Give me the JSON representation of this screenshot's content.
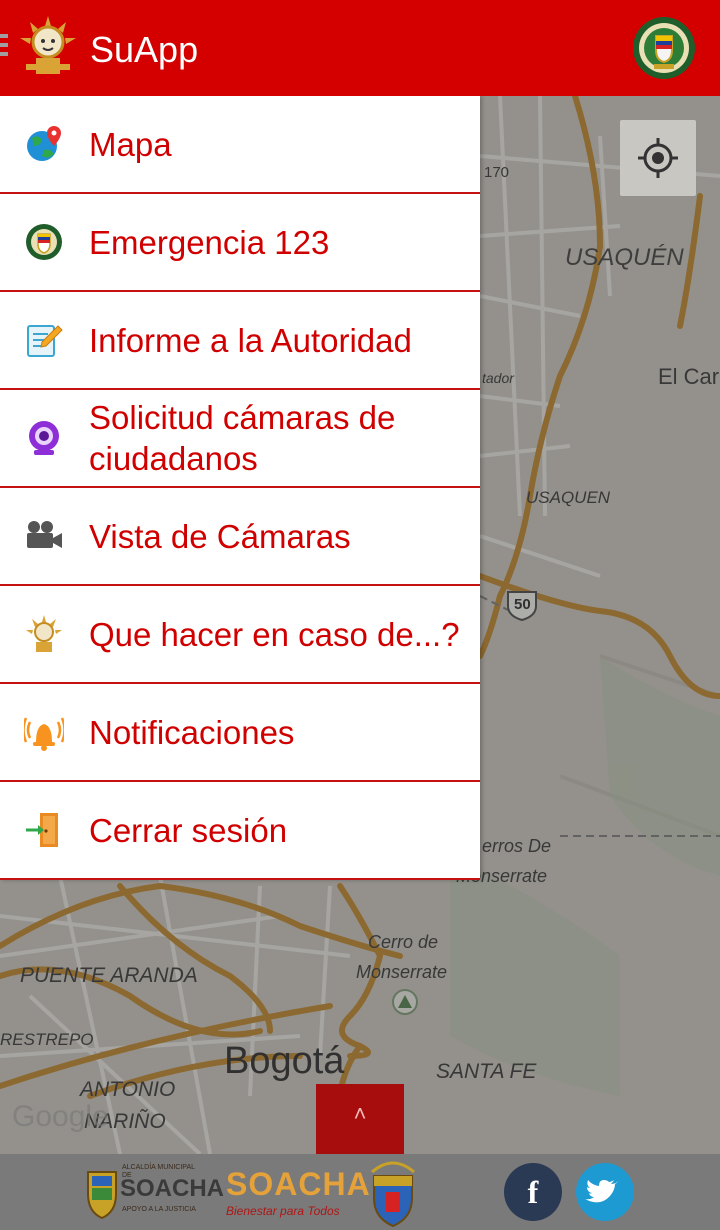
{
  "app": {
    "title": "SuApp"
  },
  "colors": {
    "brand_red": "#d40000",
    "menu_text": "#d10000",
    "divider": "#c41212"
  },
  "header": {
    "menu_icon": "hamburger-icon",
    "logo_icon": "golden-sun-logo",
    "badge_icon": "police-shield-icon"
  },
  "menu": [
    {
      "label": "Mapa",
      "icon": "globe-location-icon"
    },
    {
      "label": "Emergencia 123",
      "icon": "police-badge-icon"
    },
    {
      "label": "Informe a la Autoridad",
      "icon": "notepad-pencil-icon"
    },
    {
      "label": "Solicitud cámaras de ciudadanos",
      "icon": "webcam-icon"
    },
    {
      "label": "Vista de Cámaras",
      "icon": "video-camera-icon"
    },
    {
      "label": "Que hacer en caso de...?",
      "icon": "golden-sun-icon"
    },
    {
      "label": "Notificaciones",
      "icon": "alarm-bell-icon"
    },
    {
      "label": "Cerrar sesión",
      "icon": "exit-door-icon"
    }
  ],
  "map": {
    "labels": {
      "l170": "170",
      "usaquen_upper": "USAQUÉN",
      "el_car": "El Car",
      "tador": "tador",
      "usaquen": "USAQUEN",
      "route50": "50",
      "cerros_de": "erros De",
      "monserrate1": "Monserrate",
      "cerro_de": "Cerro de",
      "monserrate2": "Monserrate",
      "puente_aranda": "PUENTE ARANDA",
      "restrepo": "RESTREPO",
      "bogota": "Bogotá",
      "santa_fe": "SANTA FE",
      "antonio": "ANTONIO",
      "narino": "NARIÑO",
      "google": "Google"
    }
  },
  "scroll_button": {
    "glyph": "˄"
  },
  "footer": {
    "soacha_title": "SOACHA",
    "soacha_sub1": "ALCALDÍA MUNICIPAL DE",
    "soacha_sub2": "APOYO A LA JUSTICIA",
    "soacha_logo2_title": "SOACHA",
    "soacha_logo2_tagline": "Bienestar para Todos",
    "facebook_glyph": "f",
    "twitter_glyph": "t"
  }
}
